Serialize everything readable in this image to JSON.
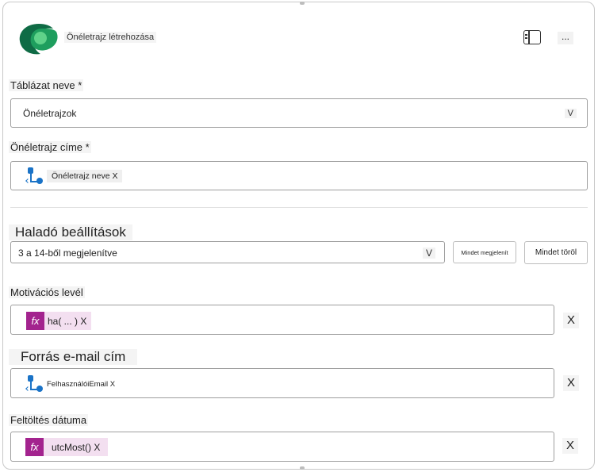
{
  "header": {
    "title": "Önéletrajz létrehozása",
    "panel_icon": "side-panel-icon",
    "more_label": "..."
  },
  "table_name": {
    "label": "Táblázat neve *",
    "value": "Önéletrajzok",
    "chevron": "V"
  },
  "resume_title": {
    "label": "Önéletrajz címe *",
    "token": "Önéletrajz neve X",
    "icon": "flow-node-icon"
  },
  "advanced": {
    "heading": "Haladó beállítások",
    "select_value": "3 a 14-ből megjelenítve",
    "chevron": "V",
    "show_all": "Mindet megjelenít",
    "clear_all": "Mindet töröl"
  },
  "motivation": {
    "label": "Motivációs levél",
    "fx": "fx",
    "token": "ha( ... ) X",
    "remove": "X"
  },
  "source_email": {
    "label": "Forrás e-mail cím",
    "token": "FelhasználóiEmail X",
    "remove": "X",
    "icon": "flow-node-icon"
  },
  "upload_date": {
    "label": "Feltöltés dátuma",
    "fx": "fx",
    "token": "utcMost() X",
    "remove": "X"
  },
  "colors": {
    "accent_fx": "#a3238e",
    "accent_flow": "#1a73c7",
    "logo_dark": "#0f6b45",
    "logo_light": "#5fd28a"
  }
}
